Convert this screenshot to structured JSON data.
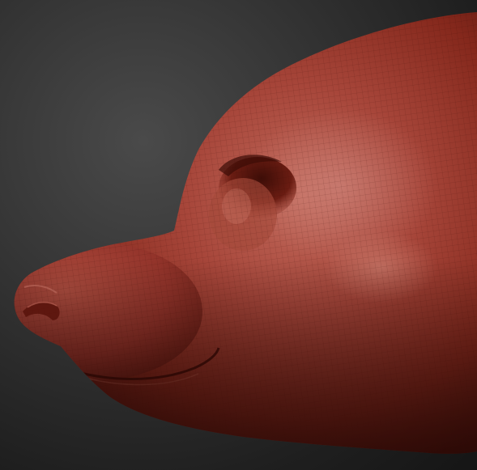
{
  "scene": {
    "subject": "sculpted-creature-head-side-view",
    "colors": {
      "background_light": "#4a4a4a",
      "background_dark": "#151515",
      "clay_highlight": "#c46a5a",
      "clay_mid": "#9a3426",
      "clay_shadow": "#4a120c",
      "wireframe": "#3a0c06"
    }
  }
}
